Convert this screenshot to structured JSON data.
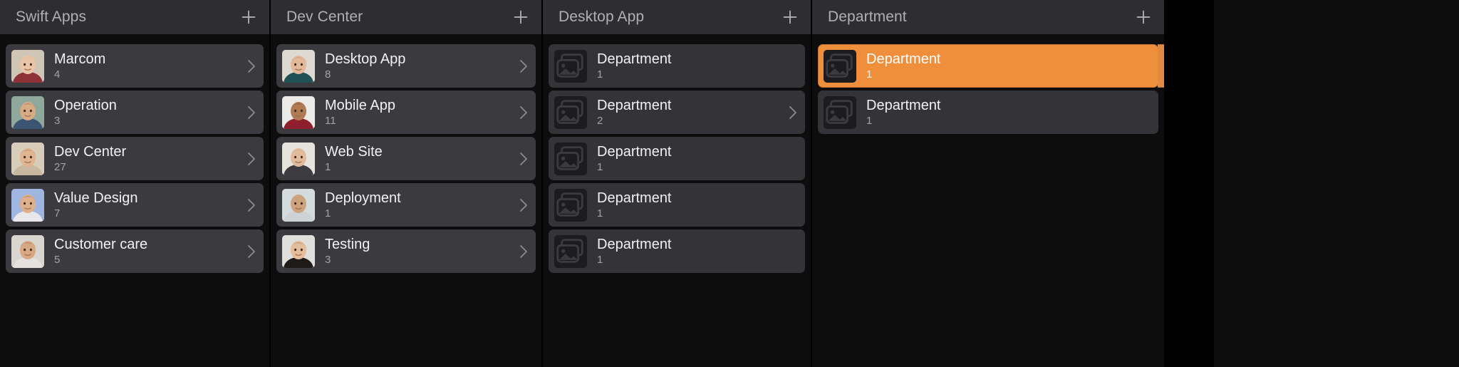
{
  "app": {
    "background": "#0d0d0e",
    "accent": "#ef8f3c",
    "header_background": "#2e2e30",
    "row_background": "#3a3a3f"
  },
  "columns": [
    {
      "title": "Swift Apps",
      "add_label": "+",
      "add_icon": "plus-icon",
      "items": [
        {
          "title": "Marcom",
          "count": "4",
          "thumb": "photo-avatar-blonde-woman",
          "chevron": true,
          "selected": false
        },
        {
          "title": "Operation",
          "count": "3",
          "thumb": "photo-avatar-man-suit",
          "chevron": true,
          "selected": false
        },
        {
          "title": "Dev Center",
          "count": "27",
          "thumb": "photo-avatar-smiling-man",
          "chevron": true,
          "selected": false
        },
        {
          "title": "Value Design",
          "count": "7",
          "thumb": "photo-avatar-curly-man",
          "chevron": true,
          "selected": false
        },
        {
          "title": "Customer care",
          "count": "5",
          "thumb": "photo-avatar-bearded-man",
          "chevron": true,
          "selected": false
        }
      ]
    },
    {
      "title": "Dev Center",
      "add_label": "+",
      "add_icon": "plus-icon",
      "items": [
        {
          "title": "Desktop App",
          "count": "8",
          "thumb": "photo-avatar-ginger-man",
          "chevron": true,
          "selected": false
        },
        {
          "title": "Mobile App",
          "count": "11",
          "thumb": "photo-avatar-young-man",
          "chevron": true,
          "selected": false
        },
        {
          "title": "Web Site",
          "count": "1",
          "thumb": "photo-avatar-blond-man",
          "chevron": true,
          "selected": false
        },
        {
          "title": "Deployment",
          "count": "1",
          "thumb": "photo-avatar-grey-man",
          "chevron": true,
          "selected": false
        },
        {
          "title": "Testing",
          "count": "3",
          "thumb": "photo-avatar-woman",
          "chevron": true,
          "selected": false
        }
      ]
    },
    {
      "title": "Desktop App",
      "add_label": "+",
      "add_icon": "plus-icon",
      "items": [
        {
          "title": "Department",
          "count": "1",
          "thumb": "image-placeholder-icon",
          "chevron": false,
          "selected": false
        },
        {
          "title": "Department",
          "count": "2",
          "thumb": "image-placeholder-icon",
          "chevron": true,
          "selected": false
        },
        {
          "title": "Department",
          "count": "1",
          "thumb": "image-placeholder-icon",
          "chevron": false,
          "selected": false
        },
        {
          "title": "Department",
          "count": "1",
          "thumb": "image-placeholder-icon",
          "chevron": false,
          "selected": false
        },
        {
          "title": "Department",
          "count": "1",
          "thumb": "image-placeholder-icon",
          "chevron": false,
          "selected": false
        }
      ]
    },
    {
      "title": "Department",
      "add_label": "+",
      "add_icon": "plus-icon",
      "items": [
        {
          "title": "Department",
          "count": "1",
          "thumb": "image-placeholder-icon",
          "chevron": false,
          "selected": true,
          "click_indicator": "click-burst-cursor-icon"
        },
        {
          "title": "Department",
          "count": "1",
          "thumb": "image-placeholder-icon",
          "chevron": false,
          "selected": false
        }
      ]
    }
  ]
}
